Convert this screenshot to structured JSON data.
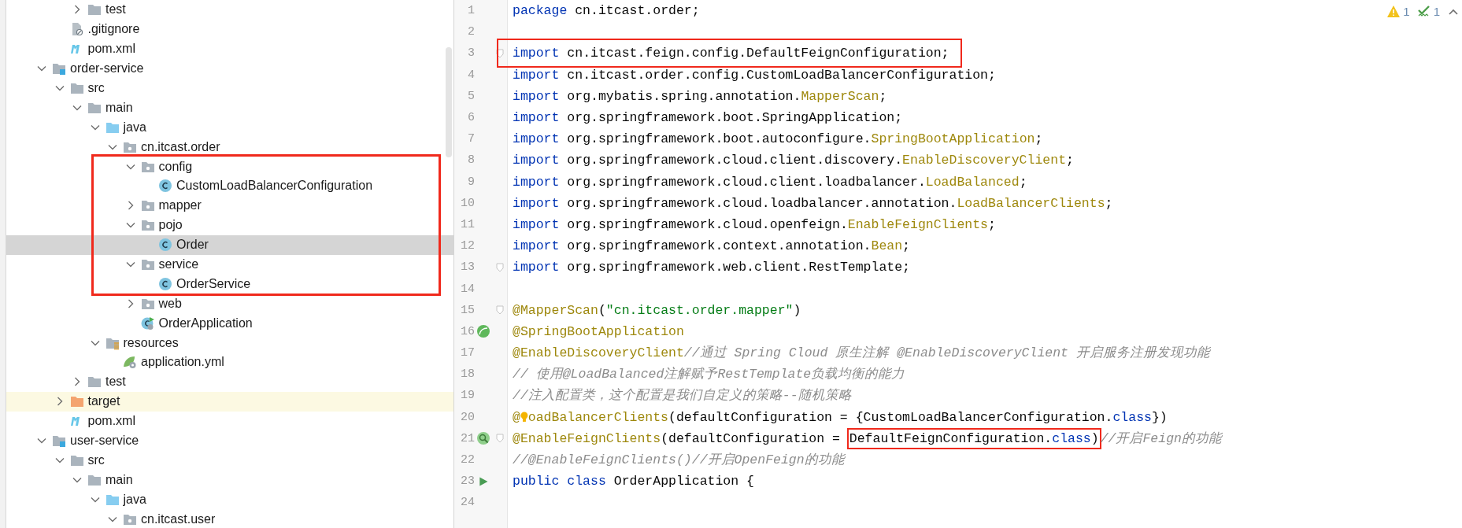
{
  "project_tree": {
    "items": [
      {
        "children": [
          {
            "children": [
              {
                "name": "test",
                "kind": "folder",
                "expanded": false,
                "selected": false
              }
            ]
          },
          {
            "name": ".gitignore",
            "kind": "ignore-file",
            "selected": false
          },
          {
            "name": "pom.xml",
            "kind": "maven",
            "selected": false
          }
        ]
      },
      {
        "name": "order-service",
        "kind": "module",
        "expanded": true,
        "selected": false,
        "children": [
          {
            "name": "src",
            "kind": "folder",
            "expanded": true,
            "selected": false,
            "children": [
              {
                "name": "main",
                "kind": "folder",
                "expanded": true,
                "selected": false,
                "children": [
                  {
                    "name": "java",
                    "kind": "source-folder",
                    "expanded": true,
                    "selected": false,
                    "children": [
                      {
                        "name": "cn.itcast.order",
                        "kind": "package",
                        "expanded": true,
                        "selected": false,
                        "children": [
                          {
                            "name": "config",
                            "kind": "package",
                            "expanded": true,
                            "selected": false,
                            "box_start": true,
                            "children": [
                              {
                                "name": "CustomLoadBalancerConfiguration",
                                "kind": "class",
                                "selected": false
                              }
                            ]
                          },
                          {
                            "name": "mapper",
                            "kind": "package",
                            "expanded": false,
                            "selected": false
                          },
                          {
                            "name": "pojo",
                            "kind": "package",
                            "expanded": true,
                            "selected": false,
                            "children": [
                              {
                                "name": "Order",
                                "kind": "class",
                                "selected": true
                              }
                            ]
                          },
                          {
                            "name": "service",
                            "kind": "package",
                            "expanded": true,
                            "selected": false,
                            "children": [
                              {
                                "name": "OrderService",
                                "kind": "class",
                                "selected": false,
                                "box_end": true
                              }
                            ]
                          },
                          {
                            "name": "web",
                            "kind": "package",
                            "expanded": false,
                            "selected": false
                          },
                          {
                            "name": "OrderApplication",
                            "kind": "spring-class",
                            "selected": false
                          }
                        ]
                      }
                    ]
                  },
                  {
                    "name": "resources",
                    "kind": "resources-folder",
                    "expanded": true,
                    "selected": false,
                    "children": [
                      {
                        "name": "application.yml",
                        "kind": "yaml",
                        "selected": false
                      }
                    ]
                  }
                ]
              },
              {
                "name": "test",
                "kind": "folder",
                "expanded": false,
                "selected": false
              }
            ]
          },
          {
            "name": "target",
            "kind": "excluded-folder",
            "expanded": false,
            "selected": false,
            "highlighted": true
          },
          {
            "name": "pom.xml",
            "kind": "maven",
            "selected": false
          }
        ]
      },
      {
        "name": "user-service",
        "kind": "module",
        "expanded": true,
        "selected": false,
        "children": [
          {
            "name": "src",
            "kind": "folder",
            "expanded": true,
            "selected": false,
            "children": [
              {
                "name": "main",
                "kind": "folder",
                "expanded": true,
                "selected": false,
                "children": [
                  {
                    "name": "java",
                    "kind": "source-folder",
                    "expanded": true,
                    "selected": false,
                    "children": [
                      {
                        "name": "cn.itcast.user",
                        "kind": "package",
                        "expanded": true,
                        "selected": false
                      }
                    ]
                  }
                ]
              }
            ]
          }
        ]
      }
    ]
  },
  "editor": {
    "inspections": [
      {
        "kind": "warning",
        "count": "1"
      },
      {
        "kind": "ok",
        "count": "1"
      }
    ],
    "lines": [
      {
        "number": "1",
        "tokens": [
          {
            "kind": "keyword",
            "text": "package"
          },
          {
            "kind": "plain",
            "text": " cn.itcast.order;"
          }
        ]
      },
      {
        "number": "2"
      },
      {
        "number": "3",
        "fold": true,
        "tokens": [
          {
            "kind": "keyword",
            "text": "import",
            "boxed": true
          },
          {
            "kind": "plain",
            "text": " cn.itcast.feign.config.DefaultFeignConfiguration;",
            "boxed": true
          }
        ]
      },
      {
        "number": "4",
        "tokens": [
          {
            "kind": "keyword",
            "text": "import"
          },
          {
            "kind": "plain",
            "text": " cn.itcast.order.config.CustomLoadBalancerConfiguration;"
          }
        ]
      },
      {
        "number": "5",
        "tokens": [
          {
            "kind": "keyword",
            "text": "import"
          },
          {
            "kind": "plain",
            "text": " org.mybatis.spring.annotation."
          },
          {
            "kind": "annotation",
            "text": "MapperScan"
          },
          {
            "kind": "plain",
            "text": ";"
          }
        ]
      },
      {
        "number": "6",
        "tokens": [
          {
            "kind": "keyword",
            "text": "import"
          },
          {
            "kind": "plain",
            "text": " org.springframework.boot.SpringApplication;"
          }
        ]
      },
      {
        "number": "7",
        "tokens": [
          {
            "kind": "keyword",
            "text": "import"
          },
          {
            "kind": "plain",
            "text": " org.springframework.boot.autoconfigure."
          },
          {
            "kind": "annotation",
            "text": "SpringBootApplication"
          },
          {
            "kind": "plain",
            "text": ";"
          }
        ]
      },
      {
        "number": "8",
        "tokens": [
          {
            "kind": "keyword",
            "text": "import"
          },
          {
            "kind": "plain",
            "text": " org.springframework.cloud.client.discovery."
          },
          {
            "kind": "annotation",
            "text": "EnableDiscoveryClient"
          },
          {
            "kind": "plain",
            "text": ";"
          }
        ]
      },
      {
        "number": "9",
        "tokens": [
          {
            "kind": "keyword",
            "text": "import"
          },
          {
            "kind": "plain",
            "text": " org.springframework.cloud.client.loadbalancer."
          },
          {
            "kind": "annotation",
            "text": "LoadBalanced"
          },
          {
            "kind": "plain",
            "text": ";"
          }
        ]
      },
      {
        "number": "10",
        "tokens": [
          {
            "kind": "keyword",
            "text": "import"
          },
          {
            "kind": "plain",
            "text": " org.springframework.cloud.loadbalancer.annotation."
          },
          {
            "kind": "annotation",
            "text": "LoadBalancerClients"
          },
          {
            "kind": "plain",
            "text": ";"
          }
        ]
      },
      {
        "number": "11",
        "tokens": [
          {
            "kind": "keyword",
            "text": "import"
          },
          {
            "kind": "plain",
            "text": " org.springframework.cloud.openfeign."
          },
          {
            "kind": "annotation",
            "text": "EnableFeignClients"
          },
          {
            "kind": "plain",
            "text": ";"
          }
        ]
      },
      {
        "number": "12",
        "tokens": [
          {
            "kind": "keyword",
            "text": "import"
          },
          {
            "kind": "plain",
            "text": " org.springframework.context.annotation."
          },
          {
            "kind": "annotation",
            "text": "Bean"
          },
          {
            "kind": "plain",
            "text": ";"
          }
        ]
      },
      {
        "number": "13",
        "fold": true,
        "tokens": [
          {
            "kind": "keyword",
            "text": "import"
          },
          {
            "kind": "plain",
            "text": " org.springframework.web.client.RestTemplate;"
          }
        ]
      },
      {
        "number": "14"
      },
      {
        "number": "15",
        "fold": true,
        "tokens": [
          {
            "kind": "annotation",
            "text": "@MapperScan"
          },
          {
            "kind": "plain",
            "text": "("
          },
          {
            "kind": "string",
            "text": "\"cn.itcast.order.mapper\""
          },
          {
            "kind": "plain",
            "text": ")"
          }
        ]
      },
      {
        "number": "16",
        "gutter_icon": {
          "kind": "spring-bean"
        },
        "tokens": [
          {
            "kind": "annotation",
            "text": "@SpringBootApplication"
          }
        ]
      },
      {
        "number": "17",
        "tokens": [
          {
            "kind": "annotation",
            "text": "@EnableDiscoveryClient"
          },
          {
            "kind": "comment",
            "text": "//通过 Spring Cloud 原生注解 @EnableDiscoveryClient 开启服务注册发现功能"
          }
        ]
      },
      {
        "number": "18",
        "tokens": [
          {
            "kind": "comment",
            "text": "// 使用@LoadBalanced注解赋予RestTemplate负载均衡的能力"
          }
        ]
      },
      {
        "number": "19",
        "tokens": [
          {
            "kind": "comment",
            "text": "//注入配置类，这个配置是我们自定义的策略--随机策略"
          }
        ]
      },
      {
        "number": "20",
        "tokens": [
          {
            "kind": "annotation",
            "text": "@"
          },
          {
            "kind": "bulb"
          },
          {
            "kind": "annotation",
            "text": "oadBalancerClients"
          },
          {
            "kind": "plain",
            "text": "(defaultConfiguration = {CustomLoadBalancerConfiguration."
          },
          {
            "kind": "keyword",
            "text": "class"
          },
          {
            "kind": "plain",
            "text": "})"
          }
        ]
      },
      {
        "number": "21",
        "gutter_icon": {
          "kind": "spring-search"
        },
        "fold": true,
        "tokens": [
          {
            "kind": "annotation",
            "text": "@EnableFeignClients"
          },
          {
            "kind": "plain",
            "text": "(defaultConfiguration = "
          },
          {
            "kind": "plain",
            "text": "DefaultFeignConfiguration.",
            "boxed": true
          },
          {
            "kind": "keyword",
            "text": "class",
            "boxed": true
          },
          {
            "kind": "plain",
            "text": ")",
            "boxed": true
          },
          {
            "kind": "comment",
            "text": "//开启Feign的功能"
          }
        ]
      },
      {
        "number": "22",
        "tokens": [
          {
            "kind": "comment",
            "text": "//@EnableFeignClients()//开启OpenFeign的功能"
          }
        ]
      },
      {
        "number": "23",
        "gutter_icon": {
          "kind": "run"
        },
        "tokens": [
          {
            "kind": "keyword",
            "text": "public class"
          },
          {
            "kind": "plain",
            "text": " OrderApplication {"
          }
        ]
      },
      {
        "number": "24"
      }
    ]
  }
}
